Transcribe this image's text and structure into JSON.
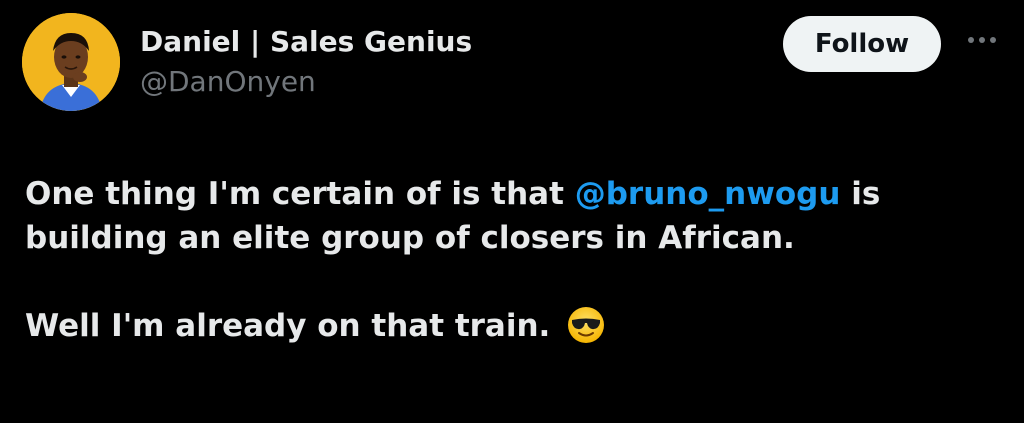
{
  "author": {
    "display_name": "Daniel | Sales Genius",
    "handle": "@DanOnyen"
  },
  "follow_label": "Follow",
  "tweet": {
    "line1_before": "One thing I'm certain of is that ",
    "mention": "@bruno_nwogu",
    "line1_after": " is",
    "line2": "building an elite group of closers in African.",
    "line3": "Well I'm already on that train. "
  },
  "colors": {
    "background": "#000000",
    "text": "#e7e9ea",
    "secondary": "#71767b",
    "link": "#1d9bf0",
    "avatar_bg": "#f2b51e"
  },
  "icons": {
    "more": "more-horizontal-icon",
    "emoji": "sunglasses-emoji-icon"
  }
}
